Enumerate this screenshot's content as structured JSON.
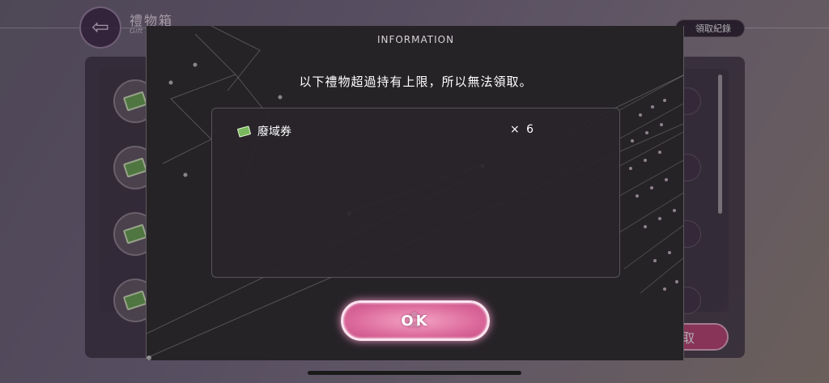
{
  "background": {
    "title": "禮物箱",
    "subtitle": "Gift",
    "history_button": "領取紀錄",
    "claim_button": "取",
    "back_icon": "arrow-left-icon"
  },
  "modal": {
    "header": "INFORMATION",
    "message": "以下禮物超過持有上限，所以無法領取。",
    "items": [
      {
        "name": "廢域券",
        "quantity": "× 6",
        "icon": "ticket-icon"
      }
    ],
    "ok_button": "OK"
  },
  "colors": {
    "modal_bg": "#262327",
    "ok_button": "#dc6a9c",
    "ticket_green": "#79b85c"
  }
}
